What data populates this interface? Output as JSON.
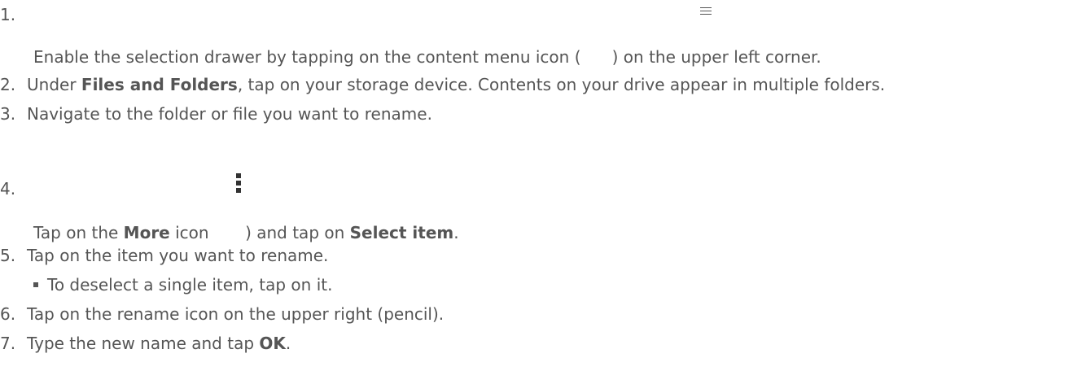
{
  "steps": [
    {
      "number": "1.",
      "text": "Enable the selection drawer by tapping on the content menu icon (      ) on the upper left corner."
    },
    {
      "number": "2.",
      "pre": "Under ",
      "bold": "Files and Folders",
      "post": ", tap on your storage device. Contents on your drive appear in multiple folders."
    },
    {
      "number": "3.",
      "text": "Navigate to the folder or file you want to rename."
    },
    {
      "number": "4.",
      "pre": "Tap on the ",
      "bold1": "More",
      "mid": " icon       ) and tap on ",
      "bold2": "Select item",
      "post": "."
    },
    {
      "number": "5.",
      "text": "Tap on the item you want to rename."
    },
    {
      "bullet": "To deselect a single item, tap on it."
    },
    {
      "number": "6.",
      "text": "Tap on the rename icon on the upper right (pencil)."
    },
    {
      "number": "7.",
      "pre": "Type the new name and tap ",
      "bold": "OK",
      "post": "."
    }
  ],
  "icons": {
    "content_menu": "menu-icon",
    "more": "more-vertical-icon"
  }
}
